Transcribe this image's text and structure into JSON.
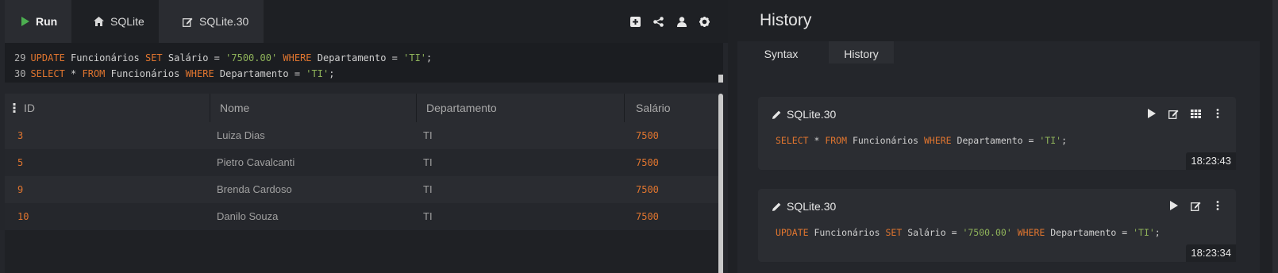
{
  "toolbar": {
    "run_label": "Run",
    "db_tab_label": "SQLite",
    "active_tab_label": "SQLite.30",
    "icons": [
      "plus-square-icon",
      "share-icon",
      "user-icon",
      "gear-icon"
    ]
  },
  "editor": {
    "lines": [
      {
        "number": "29",
        "tokens": [
          {
            "t": "kw",
            "v": "UPDATE"
          },
          {
            "t": "tx",
            "v": " Funcionários "
          },
          {
            "t": "kw",
            "v": "SET"
          },
          {
            "t": "tx",
            "v": " Salário = "
          },
          {
            "t": "str",
            "v": "'7500.00'"
          },
          {
            "t": "tx",
            "v": " "
          },
          {
            "t": "kw",
            "v": "WHERE"
          },
          {
            "t": "tx",
            "v": " Departamento = "
          },
          {
            "t": "str",
            "v": "'TI'"
          },
          {
            "t": "tx",
            "v": ";"
          }
        ]
      },
      {
        "number": "30",
        "tokens": [
          {
            "t": "kw",
            "v": "SELECT"
          },
          {
            "t": "tx",
            "v": " * "
          },
          {
            "t": "kw",
            "v": "FROM"
          },
          {
            "t": "tx",
            "v": " Funcionários "
          },
          {
            "t": "kw",
            "v": "WHERE"
          },
          {
            "t": "tx",
            "v": " Departamento = "
          },
          {
            "t": "str",
            "v": "'TI'"
          },
          {
            "t": "tx",
            "v": ";"
          }
        ]
      }
    ]
  },
  "results": {
    "columns": [
      "ID",
      "Nome",
      "Departamento",
      "Salário"
    ],
    "rows": [
      [
        "3",
        "Luiza Dias",
        "TI",
        "7500"
      ],
      [
        "5",
        "Pietro Cavalcanti",
        "TI",
        "7500"
      ],
      [
        "9",
        "Brenda Cardoso",
        "TI",
        "7500"
      ],
      [
        "10",
        "Danilo Souza",
        "TI",
        "7500"
      ]
    ]
  },
  "history": {
    "title": "History",
    "tabs": [
      "Syntax",
      "History"
    ],
    "entries": [
      {
        "title": "SQLite.30",
        "time": "18:23:43",
        "icons": [
          "play-icon",
          "edit-icon",
          "table-icon",
          "more-vertical-icon"
        ],
        "tokens": [
          {
            "t": "kw",
            "v": "SELECT"
          },
          {
            "t": "tx",
            "v": " * "
          },
          {
            "t": "kw",
            "v": "FROM"
          },
          {
            "t": "tx",
            "v": " Funcionários "
          },
          {
            "t": "kw",
            "v": "WHERE"
          },
          {
            "t": "tx",
            "v": " Departamento = "
          },
          {
            "t": "str",
            "v": "'TI'"
          },
          {
            "t": "tx",
            "v": ";"
          }
        ]
      },
      {
        "title": "SQLite.30",
        "time": "18:23:34",
        "icons": [
          "play-icon",
          "edit-icon",
          "more-vertical-icon"
        ],
        "tokens": [
          {
            "t": "kw",
            "v": "UPDATE"
          },
          {
            "t": "tx",
            "v": " Funcionários "
          },
          {
            "t": "kw",
            "v": "SET"
          },
          {
            "t": "tx",
            "v": " Salário = "
          },
          {
            "t": "str",
            "v": "'7500.00'"
          },
          {
            "t": "tx",
            "v": " "
          },
          {
            "t": "kw",
            "v": "WHERE"
          },
          {
            "t": "tx",
            "v": " Departamento = "
          },
          {
            "t": "str",
            "v": "'TI'"
          },
          {
            "t": "tx",
            "v": ";"
          }
        ]
      }
    ]
  },
  "colors": {
    "keyword": "#e0752f",
    "string": "#8fb35a",
    "run_icon": "#4caf50"
  }
}
